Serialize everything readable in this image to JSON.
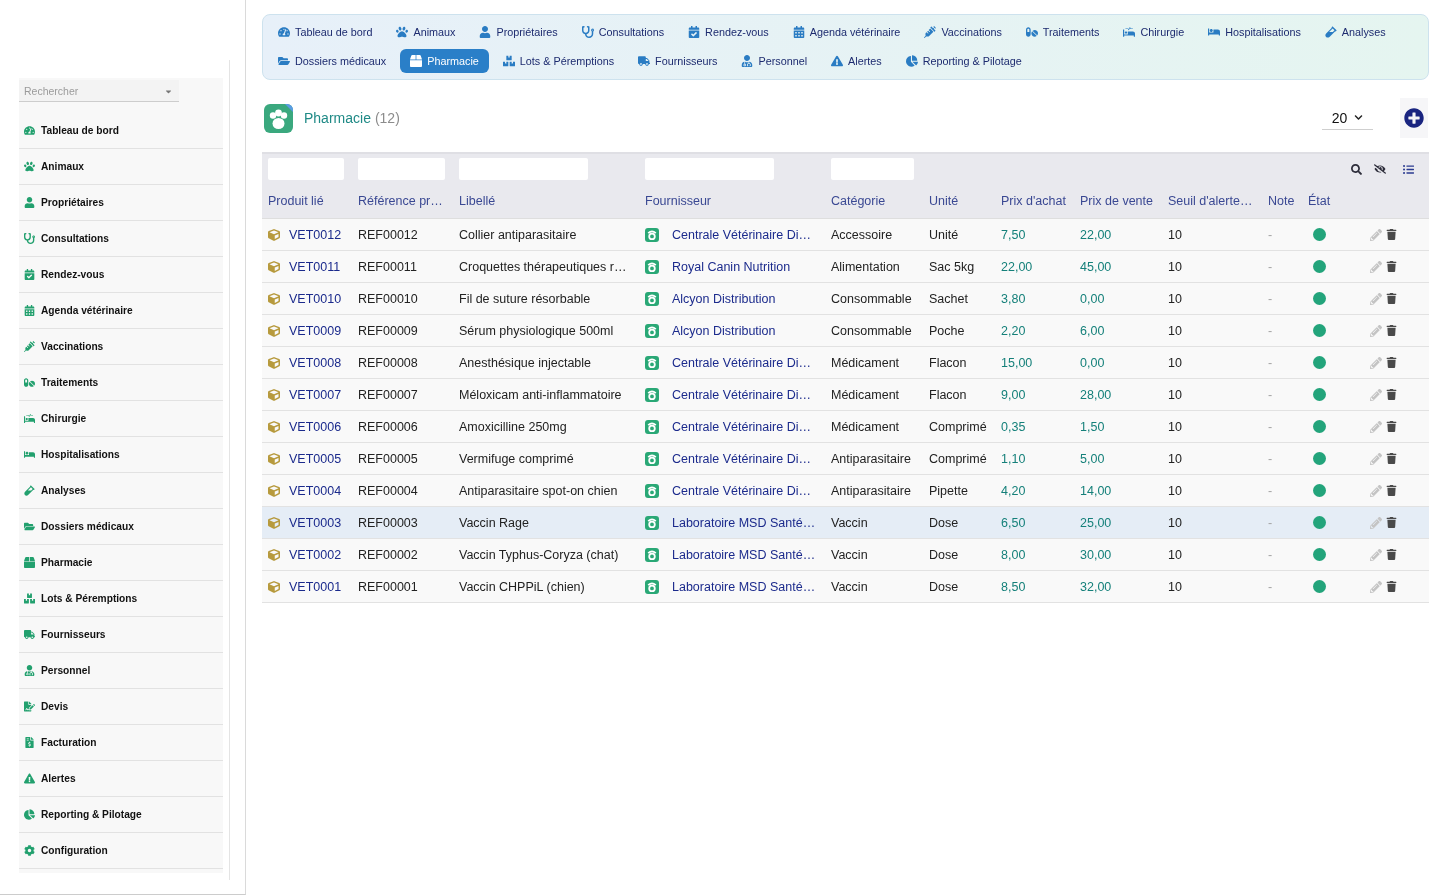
{
  "sidebar": {
    "search": {
      "placeholder": "Rechercher"
    },
    "items": [
      {
        "label": "Tableau de bord"
      },
      {
        "label": "Animaux"
      },
      {
        "label": "Propriétaires"
      },
      {
        "label": "Consultations"
      },
      {
        "label": "Rendez-vous"
      },
      {
        "label": "Agenda vétérinaire"
      },
      {
        "label": "Vaccinations"
      },
      {
        "label": "Traitements"
      },
      {
        "label": "Chirurgie"
      },
      {
        "label": "Hospitalisations"
      },
      {
        "label": "Analyses"
      },
      {
        "label": "Dossiers médicaux"
      },
      {
        "label": "Pharmacie"
      },
      {
        "label": "Lots & Péremptions"
      },
      {
        "label": "Fournisseurs"
      },
      {
        "label": "Personnel"
      },
      {
        "label": "Devis"
      },
      {
        "label": "Facturation"
      },
      {
        "label": "Alertes"
      },
      {
        "label": "Reporting & Pilotage"
      },
      {
        "label": "Configuration"
      }
    ]
  },
  "nav": {
    "tabs": [
      {
        "label": "Tableau de bord",
        "selected": false
      },
      {
        "label": "Animaux",
        "selected": false
      },
      {
        "label": "Propriétaires",
        "selected": false
      },
      {
        "label": "Consultations",
        "selected": false
      },
      {
        "label": "Rendez-vous",
        "selected": false
      },
      {
        "label": "Agenda vétérinaire",
        "selected": false
      },
      {
        "label": "Vaccinations",
        "selected": false
      },
      {
        "label": "Traitements",
        "selected": false
      },
      {
        "label": "Chirurgie",
        "selected": false
      },
      {
        "label": "Hospitalisations",
        "selected": false
      },
      {
        "label": "Analyses",
        "selected": false
      },
      {
        "label": "Dossiers médicaux",
        "selected": false
      },
      {
        "label": "Pharmacie",
        "selected": true
      },
      {
        "label": "Lots & Péremptions",
        "selected": false
      },
      {
        "label": "Fournisseurs",
        "selected": false
      },
      {
        "label": "Personnel",
        "selected": false
      },
      {
        "label": "Alertes",
        "selected": false
      },
      {
        "label": "Reporting & Pilotage",
        "selected": false
      }
    ]
  },
  "page": {
    "title": "Pharmacie",
    "count": "(12)",
    "page_size": "20"
  },
  "table": {
    "columns": [
      {
        "label": "Produit lié",
        "kind": "product",
        "filter": true
      },
      {
        "label": "Référence pr…",
        "kind": "text",
        "filter": true
      },
      {
        "label": "Libellé",
        "kind": "text",
        "filter": true
      },
      {
        "label": "Fournisseur",
        "kind": "supplier",
        "filter": true
      },
      {
        "label": "Catégorie",
        "kind": "text",
        "filter": true
      },
      {
        "label": "Unité",
        "kind": "text",
        "filter": false
      },
      {
        "label": "Prix d'achat",
        "kind": "price",
        "filter": false
      },
      {
        "label": "Prix de vente",
        "kind": "price",
        "filter": false
      },
      {
        "label": "Seuil d'alerte…",
        "kind": "text",
        "filter": false
      },
      {
        "label": "Note",
        "kind": "note",
        "filter": false
      },
      {
        "label": "État",
        "kind": "status",
        "filter": false
      }
    ],
    "rows": [
      {
        "selected": false,
        "color": "#23a47b",
        "cells": [
          "VET0012",
          "REF00012",
          "Collier antiparasitaire",
          "Centrale Vétérinaire Di…",
          "Accessoire",
          "Unité",
          "7,50",
          "22,00",
          "10",
          "-"
        ]
      },
      {
        "selected": false,
        "color": "#23a47b",
        "cells": [
          "VET0011",
          "REF00011",
          "Croquettes thérapeutiques r…",
          "Royal Canin Nutrition",
          "Alimentation",
          "Sac 5kg",
          "22,00",
          "45,00",
          "10",
          "-"
        ]
      },
      {
        "selected": false,
        "color": "#23a47b",
        "cells": [
          "VET0010",
          "REF00010",
          "Fil de suture résorbable",
          "Alcyon Distribution",
          "Consommable",
          "Sachet",
          "3,80",
          "0,00",
          "10",
          "-"
        ]
      },
      {
        "selected": false,
        "color": "#23a47b",
        "cells": [
          "VET0009",
          "REF00009",
          "Sérum physiologique 500ml",
          "Alcyon Distribution",
          "Consommable",
          "Poche",
          "2,20",
          "6,00",
          "10",
          "-"
        ]
      },
      {
        "selected": false,
        "color": "#23a47b",
        "cells": [
          "VET0008",
          "REF00008",
          "Anesthésique injectable",
          "Centrale Vétérinaire Di…",
          "Médicament",
          "Flacon",
          "15,00",
          "0,00",
          "10",
          "-"
        ]
      },
      {
        "selected": false,
        "color": "#23a47b",
        "cells": [
          "VET0007",
          "REF00007",
          "Méloxicam anti-inflammatoire",
          "Centrale Vétérinaire Di…",
          "Médicament",
          "Flacon",
          "9,00",
          "28,00",
          "10",
          "-"
        ]
      },
      {
        "selected": false,
        "color": "#23a47b",
        "cells": [
          "VET0006",
          "REF00006",
          "Amoxicilline 250mg",
          "Centrale Vétérinaire Di…",
          "Médicament",
          "Comprimé",
          "0,35",
          "1,50",
          "10",
          "-"
        ]
      },
      {
        "selected": false,
        "color": "#23a47b",
        "cells": [
          "VET0005",
          "REF00005",
          "Vermifuge comprimé",
          "Centrale Vétérinaire Di…",
          "Antiparasitaire",
          "Comprimé",
          "1,10",
          "5,00",
          "10",
          "-"
        ]
      },
      {
        "selected": false,
        "color": "#23a47b",
        "cells": [
          "VET0004",
          "REF00004",
          "Antiparasitaire spot-on chien",
          "Centrale Vétérinaire Di…",
          "Antiparasitaire",
          "Pipette",
          "4,20",
          "14,00",
          "10",
          "-"
        ]
      },
      {
        "selected": true,
        "color": "#23a47b",
        "cells": [
          "VET0003",
          "REF00003",
          "Vaccin Rage",
          "Laboratoire MSD Santé…",
          "Vaccin",
          "Dose",
          "6,50",
          "25,00",
          "10",
          "-"
        ]
      },
      {
        "selected": false,
        "color": "#23a47b",
        "cells": [
          "VET0002",
          "REF00002",
          "Vaccin Typhus-Coryza (chat)",
          "Laboratoire MSD Santé…",
          "Vaccin",
          "Dose",
          "8,00",
          "30,00",
          "10",
          "-"
        ]
      },
      {
        "selected": false,
        "color": "#23a47b",
        "cells": [
          "VET0001",
          "REF00001",
          "Vaccin CHPPiL (chien)",
          "Laboratoire MSD Santé…",
          "Vaccin",
          "Dose",
          "8,50",
          "32,00",
          "10",
          "-"
        ]
      }
    ]
  }
}
